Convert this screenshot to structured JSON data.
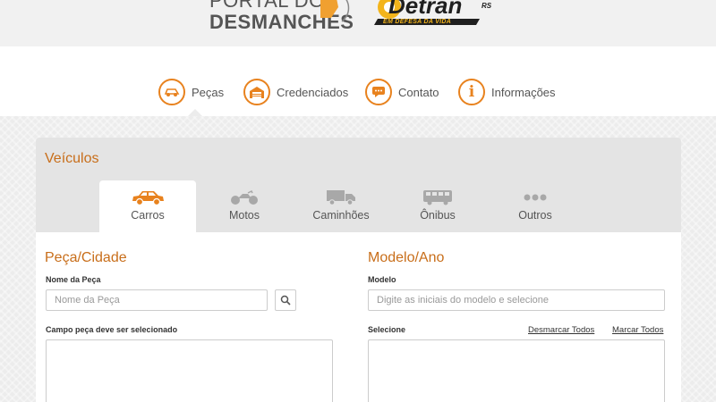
{
  "header": {
    "brand_line1": "PORTAL DOS",
    "brand_line2": "DESMANCHES",
    "detran_name": "Detran",
    "detran_state": "RS",
    "detran_slogan": "EM DEFESA DA VIDA"
  },
  "nav": {
    "items": [
      {
        "label": "Peças",
        "icon": "car-parts-icon"
      },
      {
        "label": "Credenciados",
        "icon": "garage-icon"
      },
      {
        "label": "Contato",
        "icon": "chat-bubble-icon"
      },
      {
        "label": "Informações",
        "icon": "info-icon"
      }
    ]
  },
  "panel": {
    "title": "Veículos",
    "tabs": [
      {
        "label": "Carros",
        "icon": "car-icon",
        "active": true
      },
      {
        "label": "Motos",
        "icon": "motorcycle-icon",
        "active": false
      },
      {
        "label": "Caminhões",
        "icon": "truck-icon",
        "active": false
      },
      {
        "label": "Ônibus",
        "icon": "bus-icon",
        "active": false
      },
      {
        "label": "Outros",
        "icon": "more-dots-icon",
        "active": false
      }
    ]
  },
  "left": {
    "title": "Peça/Cidade",
    "part_label": "Nome da Peça",
    "part_placeholder": "Nome da Peça",
    "part_value": "",
    "select_label": "Campo peça deve ser selecionado"
  },
  "right": {
    "title": "Modelo/Ano",
    "model_label": "Modelo",
    "model_placeholder": "Digite as iniciais do modelo e selecione",
    "model_value": "",
    "select_label": "Selecione",
    "unselect_all": "Desmarcar Todos",
    "select_all": "Marcar Todos"
  },
  "colors": {
    "accent": "#e8821e",
    "accent_dark": "#c86e1a",
    "text": "#555555",
    "icon_gray": "#a8a8a8"
  }
}
